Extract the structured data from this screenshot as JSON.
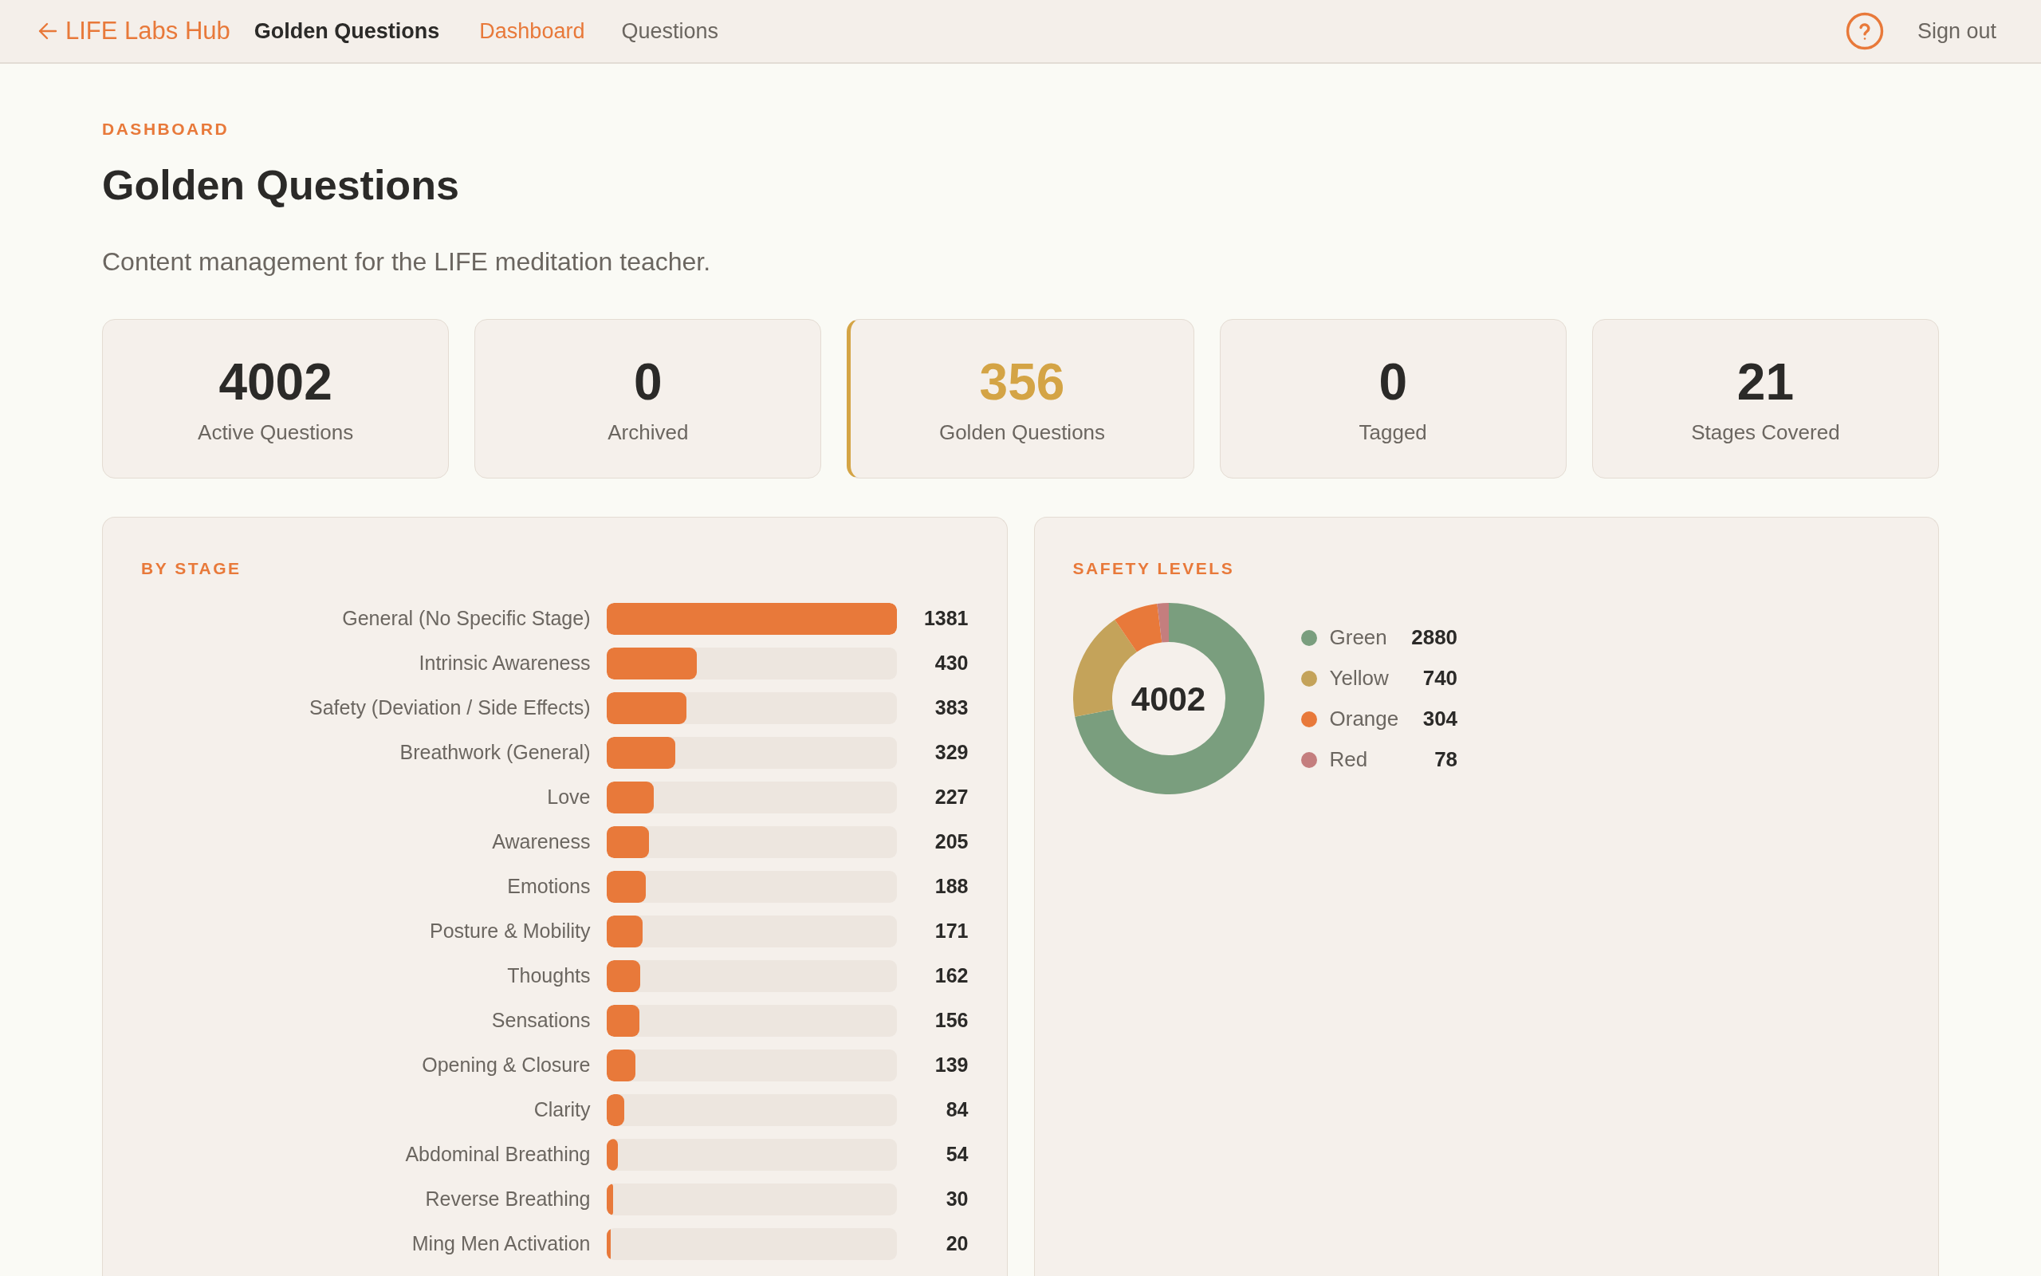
{
  "nav": {
    "back_link": "LIFE Labs Hub",
    "app_title": "Golden Questions",
    "tabs": [
      {
        "label": "Dashboard",
        "selected": true
      },
      {
        "label": "Questions",
        "selected": false
      }
    ],
    "sign_out": "Sign out"
  },
  "header": {
    "eyebrow": "DASHBOARD",
    "title": "Golden Questions",
    "subtitle": "Content management for the LIFE meditation teacher."
  },
  "stats": [
    {
      "value": "4002",
      "label": "Active Questions",
      "highlighted": false
    },
    {
      "value": "0",
      "label": "Archived",
      "highlighted": false
    },
    {
      "value": "356",
      "label": "Golden Questions",
      "highlighted": true
    },
    {
      "value": "0",
      "label": "Tagged",
      "highlighted": false
    },
    {
      "value": "21",
      "label": "Stages Covered",
      "highlighted": false
    }
  ],
  "by_stage": {
    "title": "BY STAGE",
    "rows": [
      {
        "label": "General (No Specific Stage)",
        "count": "1381",
        "level": 1
      },
      {
        "label": "Intrinsic Awareness",
        "count": "430",
        "level": 0.311
      },
      {
        "label": "Safety (Deviation / Side Effects)",
        "count": "383",
        "level": 0.277
      },
      {
        "label": "Breathwork (General)",
        "count": "329",
        "level": 0.238
      },
      {
        "label": "Love",
        "count": "227",
        "level": 0.164
      },
      {
        "label": "Awareness",
        "count": "205",
        "level": 0.148
      },
      {
        "label": "Emotions",
        "count": "188",
        "level": 0.136
      },
      {
        "label": "Posture & Mobility",
        "count": "171",
        "level": 0.124
      },
      {
        "label": "Thoughts",
        "count": "162",
        "level": 0.117
      },
      {
        "label": "Sensations",
        "count": "156",
        "level": 0.113
      },
      {
        "label": "Opening & Closure",
        "count": "139",
        "level": 0.101
      },
      {
        "label": "Clarity",
        "count": "84",
        "level": 0.061
      },
      {
        "label": "Abdominal Breathing",
        "count": "54",
        "level": 0.039
      },
      {
        "label": "Reverse Breathing",
        "count": "30",
        "level": 0.022
      },
      {
        "label": "Ming Men Activation",
        "count": "20",
        "level": 0.014
      }
    ]
  },
  "safety_levels": {
    "title": "SAFETY LEVELS",
    "chart_data": {
      "type": "donut",
      "categories": [
        "Green",
        "Yellow",
        "Orange",
        "Red"
      ],
      "values": [
        2880,
        740,
        304,
        78
      ],
      "colors": [
        "#7a9e7e",
        "#c4a35a",
        "#e8793a",
        "#c47e7e"
      ],
      "data_labels": true,
      "legend": "right"
    },
    "total": "4002"
  }
}
